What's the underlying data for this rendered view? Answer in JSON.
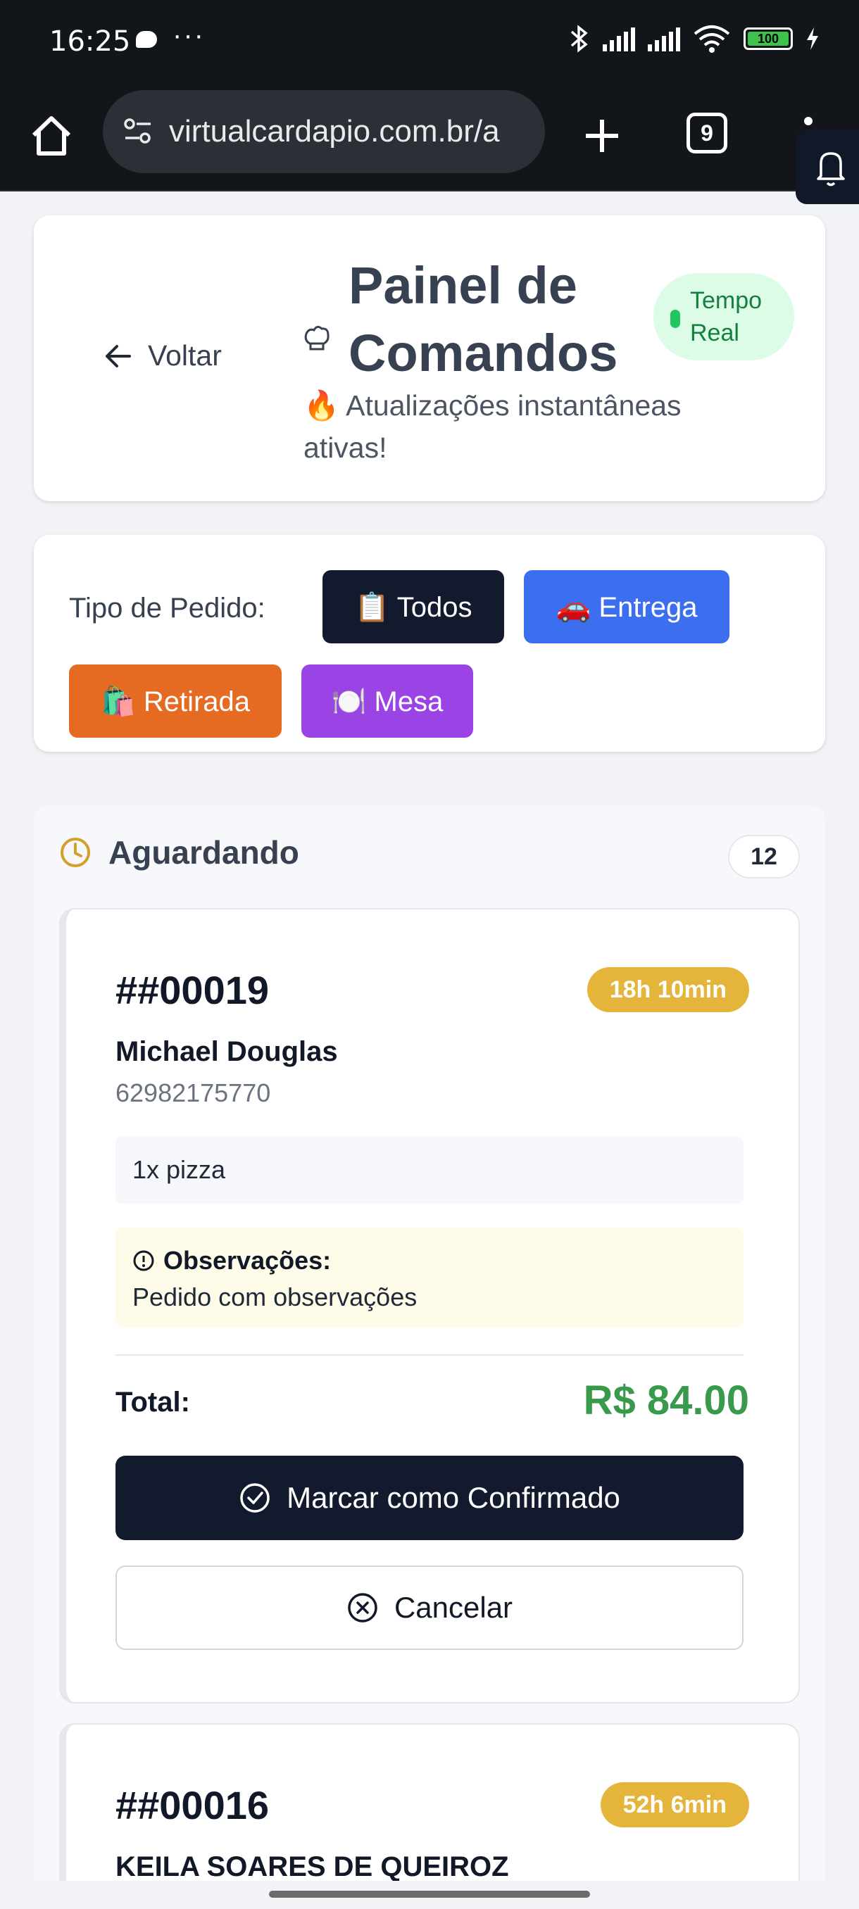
{
  "status_bar": {
    "time": "16:25",
    "dots": "···",
    "battery": "100"
  },
  "browser": {
    "url": "virtualcardapio.com.br/a",
    "tab_count": "9"
  },
  "header": {
    "back_label": "Voltar",
    "title": "Painel de Comandos",
    "subtitle": "🔥 Atualizações instantâneas ativas!",
    "realtime_badge": "Tempo Real"
  },
  "filters": {
    "label": "Tipo de Pedido:",
    "options": [
      {
        "label": "📋 Todos",
        "color": "#141a2e",
        "active": true
      },
      {
        "label": "🚗 Entrega",
        "color": "#3b6ff0"
      },
      {
        "label": "🛍️ Retirada",
        "color": "#e56a22"
      },
      {
        "label": "🍽️ Mesa",
        "color": "#9b44e6"
      }
    ]
  },
  "column": {
    "title": "Aguardando",
    "count": "12",
    "icon": "clock-icon",
    "accent": "#d4a02a"
  },
  "orders": [
    {
      "number": "##00019",
      "elapsed": "18h 10min",
      "customer": "Michael Douglas",
      "phone": "62982175770",
      "items": "1x pizza",
      "notes_label": "Observações:",
      "notes": "Pedido com observações",
      "total_label": "Total:",
      "total": "R$ 84.00",
      "confirm_label": "Marcar como Confirmado",
      "cancel_label": "Cancelar"
    },
    {
      "number": "##00016",
      "elapsed": "52h 6min",
      "customer": "KEILA SOARES DE QUEIROZ"
    }
  ]
}
